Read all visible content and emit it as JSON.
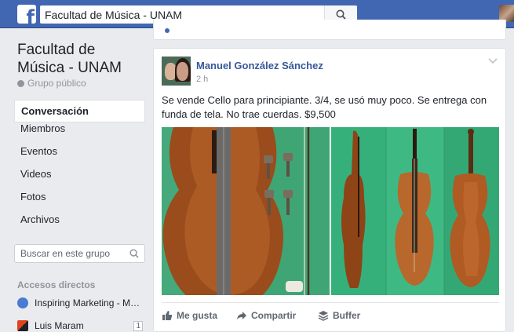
{
  "topbar": {
    "logo_letter": "f",
    "search_value": "Facultad de Música - UNAM",
    "brand_color": "#4267b2"
  },
  "group": {
    "name": "Facultad de Música - UNAM",
    "privacy": "Grupo público"
  },
  "sidebar": {
    "items": [
      {
        "label": "Conversación",
        "active": true
      },
      {
        "label": "Miembros"
      },
      {
        "label": "Eventos"
      },
      {
        "label": "Videos"
      },
      {
        "label": "Fotos"
      },
      {
        "label": "Archivos"
      }
    ],
    "search_placeholder": "Buscar en este grupo",
    "shortcuts_heading": "Accesos directos",
    "shortcuts": [
      {
        "label": "Inspiring Marketing - Ma...",
        "icon": "group-icon"
      },
      {
        "label": "Luis Maram",
        "icon": "page-icon",
        "count": "1"
      }
    ]
  },
  "post": {
    "author": "Manuel González Sánchez",
    "time": "2 h",
    "text": "Se vende Cello para principiante. 3/4, se usó muy poco. Se entrega con funda de tela. No trae cuerdas. $9,500",
    "photos": [
      "cello-front-bow-pegs-photo",
      "cello-three-views-photo"
    ],
    "actions": {
      "like": "Me gusta",
      "share": "Compartir",
      "buffer": "Buffer"
    }
  }
}
